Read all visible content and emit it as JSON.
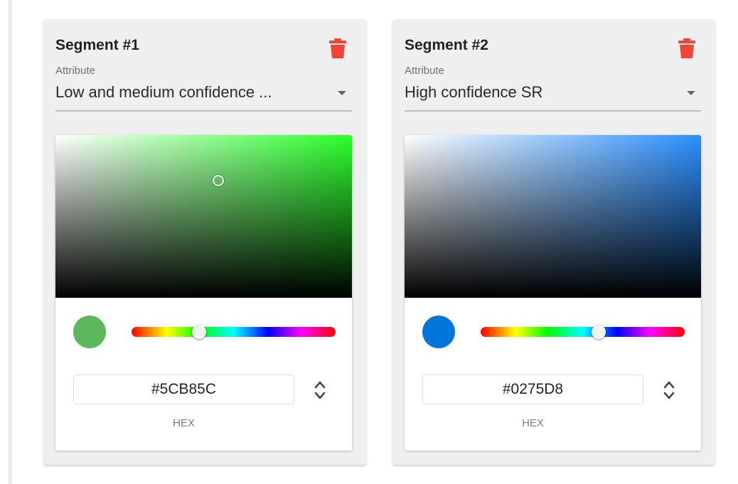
{
  "segments": [
    {
      "title": "Segment #1",
      "attribute_label": "Attribute",
      "attribute_value": "Low and medium confidence ...",
      "base_hue_color": "#2bff2b",
      "selected_color": "#5CB85C",
      "hue_position": 0.33,
      "hex_value": "#5CB85C",
      "mode_label": "HEX",
      "icons": {
        "delete": "trash-icon",
        "dropdown": "caret-down-icon",
        "mode_toggle": "unfold-icon"
      }
    },
    {
      "title": "Segment #2",
      "attribute_label": "Attribute",
      "attribute_value": "High confidence SR",
      "base_hue_color": "#2b8fff",
      "selected_color": "#0275D8",
      "hue_position": 0.58,
      "hex_value": "#0275D8",
      "mode_label": "HEX",
      "icons": {
        "delete": "trash-icon",
        "dropdown": "caret-down-icon",
        "mode_toggle": "unfold-icon"
      }
    }
  ],
  "colors": {
    "delete_red": "#f44336",
    "card_bg": "#efefef"
  }
}
